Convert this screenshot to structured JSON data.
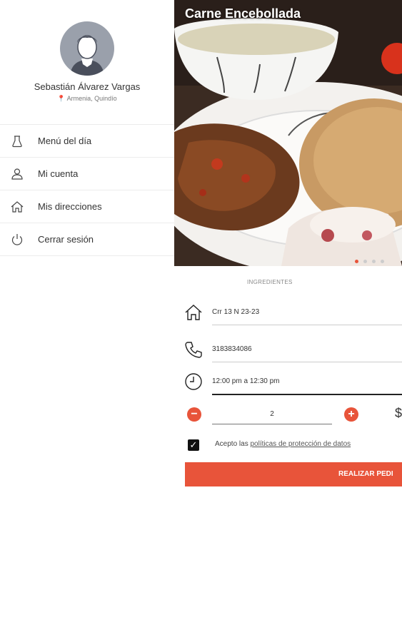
{
  "drawer": {
    "user_name": "Sebastián Álvarez Vargas",
    "user_location": "Armenia, Quindío",
    "menu": [
      {
        "label": "Menú del día",
        "icon": "chef-icon"
      },
      {
        "label": "Mi cuenta",
        "icon": "user-icon"
      },
      {
        "label": "Mis direcciones",
        "icon": "home-icon"
      },
      {
        "label": "Cerrar sesión",
        "icon": "power-icon"
      }
    ]
  },
  "main": {
    "title": "Carne Encebollada",
    "carousel": {
      "count": 4,
      "active_index": 0
    },
    "ingredients_label": "INGREDIENTES",
    "address": "Crr 13 N 23-23",
    "phone": "3183834086",
    "time": "12:00 pm a 12:30 pm",
    "quantity": "2",
    "price_prefix": "$",
    "terms_prefix": "Acepto las",
    "terms_link": "políticas de protección de datos",
    "terms_checked": true,
    "order_button": "REALIZAR PEDI"
  },
  "colors": {
    "accent": "#e8543a",
    "avatar": "#9aa0ab"
  }
}
